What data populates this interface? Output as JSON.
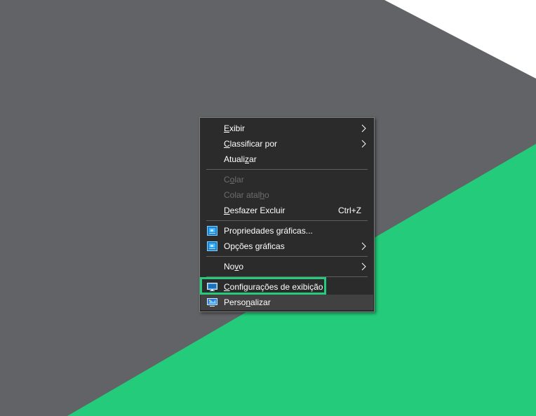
{
  "colors": {
    "background_gray": "#626367",
    "background_green": "#23cb7b",
    "background_white": "#ffffff",
    "menu_bg": "#2b2b2b",
    "highlight_border": "#23cb7b"
  },
  "menu": {
    "items": [
      {
        "pre": "",
        "ul": "E",
        "post": "xibir",
        "submenu": true
      },
      {
        "pre": "",
        "ul": "C",
        "post": "lassificar por",
        "submenu": true
      },
      {
        "pre": "Atuali",
        "ul": "z",
        "post": "ar"
      },
      {
        "pre": "C",
        "ul": "o",
        "post": "lar",
        "disabled": true
      },
      {
        "pre": "Colar atal",
        "ul": "h",
        "post": "o",
        "disabled": true
      },
      {
        "pre": "",
        "ul": "D",
        "post": "esfazer Excluir",
        "shortcut": "Ctrl+Z"
      },
      {
        "pre": "Propriedades gráficas...",
        "ul": "",
        "post": "",
        "icon": "intel-graphics-icon"
      },
      {
        "pre": "Opções gráficas",
        "ul": "",
        "post": "",
        "icon": "intel-graphics-icon",
        "submenu": true
      },
      {
        "pre": "No",
        "ul": "v",
        "post": "o",
        "submenu": true
      },
      {
        "pre": "",
        "ul": "C",
        "post": "onfigurações de exibição",
        "icon": "display-settings-icon"
      },
      {
        "pre": "Perso",
        "ul": "n",
        "post": "alizar",
        "icon": "personalize-icon"
      }
    ]
  }
}
